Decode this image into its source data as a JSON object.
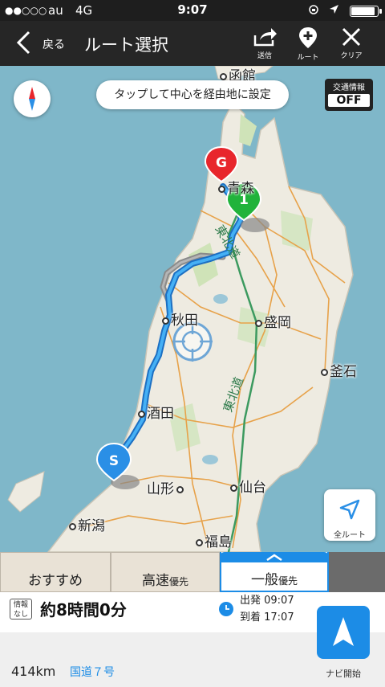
{
  "status_bar": {
    "signal": "●●○○○",
    "carrier": "au",
    "network": "4G",
    "time": "9:07",
    "battery_level": 0.95
  },
  "nav": {
    "back_label": "戻る",
    "title": "ルート選択",
    "actions": [
      {
        "label": "送信",
        "icon": "share-icon"
      },
      {
        "label": "ルート",
        "icon": "add-waypoint-icon"
      },
      {
        "label": "クリア",
        "icon": "close-icon"
      }
    ]
  },
  "map": {
    "tap_hint": "タップして中心を経由地に設定",
    "traffic": {
      "label": "交通情報",
      "state": "OFF"
    },
    "all_route_label": "全ルート",
    "markers": {
      "goal": "G",
      "waypoint": "1",
      "start": "S"
    },
    "cities": [
      "函館",
      "青森",
      "秋田",
      "盛岡",
      "釜石",
      "酒田",
      "山形",
      "仙台",
      "新潟",
      "福島"
    ],
    "road_labels": [
      "東北道",
      "東北道"
    ],
    "colors": {
      "sea": "#7fb7c9",
      "land": "#eeebe1",
      "route": "#2f9be8",
      "alt_route": "#8a8a8a"
    }
  },
  "tabs": [
    {
      "main": "おすすめ",
      "sub": ""
    },
    {
      "main": "高速",
      "sub": "優先"
    },
    {
      "main": "一般",
      "sub": "優先"
    }
  ],
  "route_info": {
    "badge": "情報なし",
    "badge_line1": "情報",
    "badge_line2": "なし",
    "duration": "約8時間0分",
    "departure": "出発 09:07",
    "arrival": "到着 17:07",
    "distance": "414km",
    "road": "国道７号",
    "navi_label": "ナビ開始"
  }
}
